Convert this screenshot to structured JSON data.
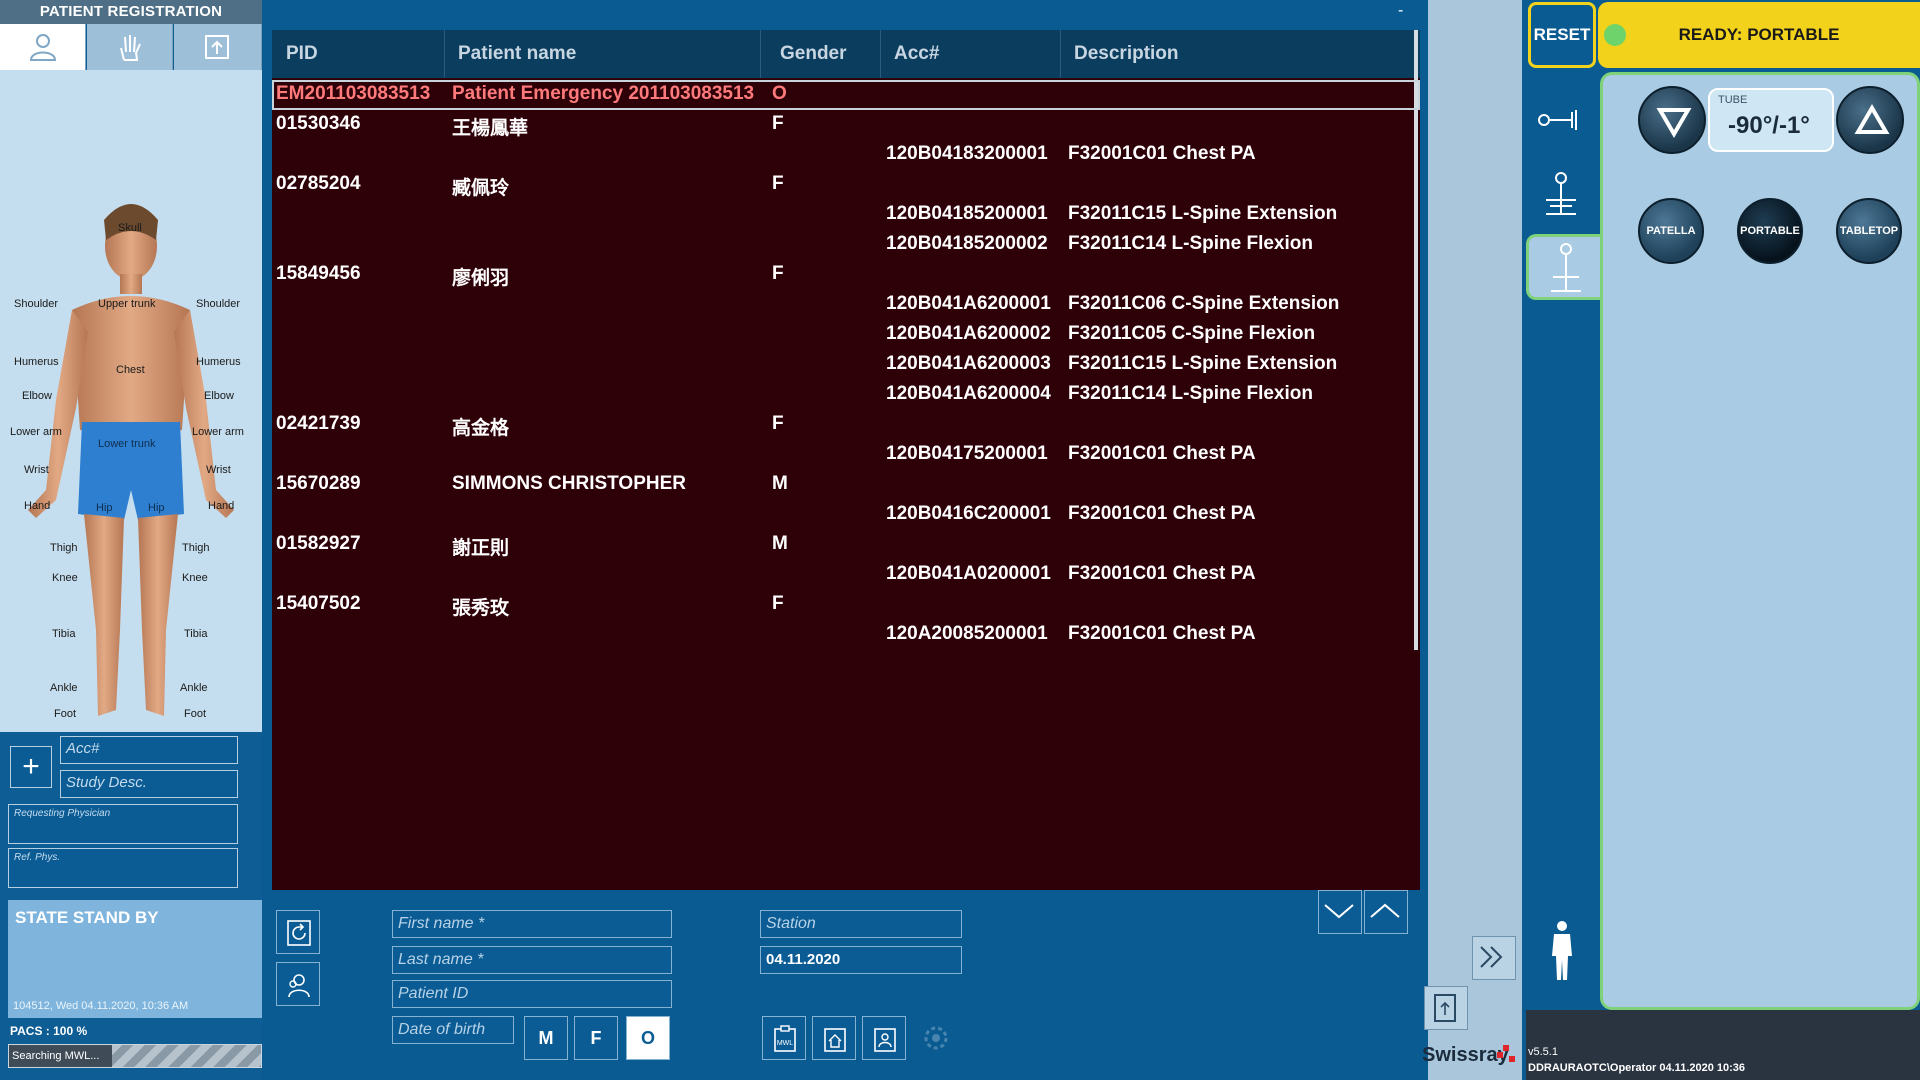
{
  "left": {
    "title": "PATIENT REGISTRATION",
    "tabs": [
      "person-icon",
      "hand-icon",
      "upload-icon"
    ],
    "body_labels": {
      "skull": "Skull",
      "upper_trunk": "Upper trunk",
      "shoulder_l": "Shoulder",
      "shoulder_r": "Shoulder",
      "chest": "Chest",
      "humerus_l": "Humerus",
      "humerus_r": "Humerus",
      "elbow_l": "Elbow",
      "elbow_r": "Elbow",
      "lower_arm_l": "Lower arm",
      "lower_arm_r": "Lower arm",
      "lower_trunk": "Lower trunk",
      "wrist_l": "Wrist",
      "wrist_r": "Wrist",
      "hand_l": "Hand",
      "hand_r": "Hand",
      "hip_l": "Hip",
      "hip_r": "Hip",
      "thigh_l": "Thigh",
      "thigh_r": "Thigh",
      "knee_l": "Knee",
      "knee_r": "Knee",
      "tibia_l": "Tibia",
      "tibia_r": "Tibia",
      "ankle_l": "Ankle",
      "ankle_r": "Ankle",
      "foot_l": "Foot",
      "foot_r": "Foot"
    },
    "acc_placeholder": "Acc#",
    "study_placeholder": "Study Desc.",
    "requesting_physician": "Requesting Physician",
    "ref_phys": "Ref. Phys.",
    "state_title": "STATE STAND BY",
    "state_time": "104512, Wed 04.11.2020, 10:36 AM",
    "pacs": "PACS : 100 %",
    "search_status": "Searching MWL..."
  },
  "list": {
    "headers": [
      "PID",
      "Patient name",
      "Gender",
      "Acc#",
      "Description"
    ],
    "minimize": "-",
    "rows": [
      {
        "pid": "EM201103083513",
        "name": "Patient Emergency 201103083513",
        "gender": "O",
        "acc": "",
        "desc": "",
        "emergency": true
      },
      {
        "pid": "01530346",
        "name": "王楊鳳華",
        "gender": "F",
        "acc": "",
        "desc": ""
      },
      {
        "pid": "",
        "name": "",
        "gender": "",
        "acc": "120B04183200001",
        "desc": "F32001C01 Chest PA"
      },
      {
        "pid": "02785204",
        "name": "臧佩玲",
        "gender": "F",
        "acc": "",
        "desc": ""
      },
      {
        "pid": "",
        "name": "",
        "gender": "",
        "acc": "120B04185200001",
        "desc": "F32011C15 L-Spine Extension"
      },
      {
        "pid": "",
        "name": "",
        "gender": "",
        "acc": "120B04185200002",
        "desc": "F32011C14 L-Spine Flexion"
      },
      {
        "pid": "15849456",
        "name": "廖俐羽",
        "gender": "F",
        "acc": "",
        "desc": ""
      },
      {
        "pid": "",
        "name": "",
        "gender": "",
        "acc": "120B041A6200001",
        "desc": "F32011C06 C-Spine Extension"
      },
      {
        "pid": "",
        "name": "",
        "gender": "",
        "acc": "120B041A6200002",
        "desc": "F32011C05 C-Spine Flexion"
      },
      {
        "pid": "",
        "name": "",
        "gender": "",
        "acc": "120B041A6200003",
        "desc": "F32011C15 L-Spine Extension"
      },
      {
        "pid": "",
        "name": "",
        "gender": "",
        "acc": "120B041A6200004",
        "desc": "F32011C14 L-Spine Flexion"
      },
      {
        "pid": "02421739",
        "name": "高金格",
        "gender": "F",
        "acc": "",
        "desc": ""
      },
      {
        "pid": "",
        "name": "",
        "gender": "",
        "acc": "120B04175200001",
        "desc": "F32001C01 Chest PA"
      },
      {
        "pid": "15670289",
        "name": "SIMMONS CHRISTOPHER",
        "gender": "M",
        "acc": "",
        "desc": ""
      },
      {
        "pid": "",
        "name": "",
        "gender": "",
        "acc": "120B0416C200001",
        "desc": "F32001C01 Chest PA"
      },
      {
        "pid": "01582927",
        "name": "謝正則",
        "gender": "M",
        "acc": "",
        "desc": ""
      },
      {
        "pid": "",
        "name": "",
        "gender": "",
        "acc": "120B041A0200001",
        "desc": "F32001C01 Chest PA"
      },
      {
        "pid": "15407502",
        "name": "張秀玫",
        "gender": "F",
        "acc": "",
        "desc": ""
      },
      {
        "pid": "",
        "name": "",
        "gender": "",
        "acc": "120A20085200001",
        "desc": "F32001C01 Chest PA"
      }
    ]
  },
  "form": {
    "first_name": "First name *",
    "last_name": "Last name *",
    "patient_id": "Patient ID",
    "dob": "Date of birth",
    "station": "Station",
    "date": "04.11.2020",
    "gender_m": "M",
    "gender_f": "F",
    "gender_o": "O",
    "selected_gender": "O",
    "mwl_label": "MWL"
  },
  "right": {
    "reset": "RESET",
    "ready": "READY: PORTABLE",
    "tube_label": "TUBE",
    "tube_value": "-90°/-1°",
    "modes": [
      "PATELLA",
      "PORTABLE",
      "TABLETOP"
    ],
    "selected_mode": "PORTABLE",
    "brand": "Swissray",
    "version": "v5.5.1",
    "operator": "DDRAURAOTC\\Operator 04.11.2020 10:36"
  },
  "colors": {
    "accent_yellow": "#f2d21b",
    "accent_green": "#7fd27a",
    "list_bg": "#2e0109",
    "emergency_text": "#ff7a7a",
    "panel_blue": "#0a5b92"
  }
}
